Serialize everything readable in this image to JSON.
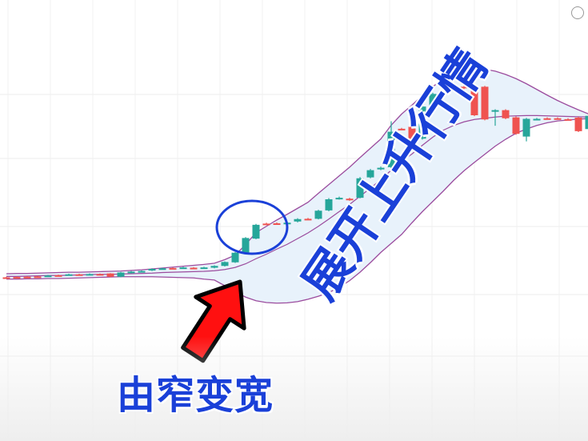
{
  "labels": {
    "bottom_caption": "由窄变宽",
    "diagonal_caption": "展开上升行情"
  },
  "colors": {
    "bull": "#26a69a",
    "bear": "#ef5350",
    "band": "#9b4c9e",
    "band_fill": "#e8f2fb",
    "annotation_blue": "#1a40d8",
    "arrow_red": "#ff1010"
  },
  "chart_data": {
    "type": "candlestick",
    "title": "",
    "xlabel": "",
    "ylabel": "",
    "grid": true,
    "ylim": [
      0,
      100
    ],
    "candles": [
      {
        "o": 11.6,
        "c": 11.6,
        "h": 11.8,
        "l": 11.4,
        "dir": "bear"
      },
      {
        "o": 11.7,
        "c": 11.7,
        "h": 11.9,
        "l": 11.5,
        "dir": "bear"
      },
      {
        "o": 11.8,
        "c": 11.8,
        "h": 12.0,
        "l": 11.6,
        "dir": "bear"
      },
      {
        "o": 11.9,
        "c": 11.9,
        "h": 12.1,
        "l": 11.7,
        "dir": "bear"
      },
      {
        "o": 12.0,
        "c": 12.2,
        "h": 12.4,
        "l": 11.8,
        "dir": "bull"
      },
      {
        "o": 12.3,
        "c": 12.3,
        "h": 12.5,
        "l": 12.1,
        "dir": "bear"
      },
      {
        "o": 12.4,
        "c": 12.6,
        "h": 12.8,
        "l": 12.2,
        "dir": "bull"
      },
      {
        "o": 12.6,
        "c": 12.6,
        "h": 12.8,
        "l": 12.4,
        "dir": "bear"
      },
      {
        "o": 12.7,
        "c": 12.7,
        "h": 12.9,
        "l": 12.5,
        "dir": "bull"
      },
      {
        "o": 12.7,
        "c": 12.7,
        "h": 12.9,
        "l": 12.5,
        "dir": "bear"
      },
      {
        "o": 12.9,
        "c": 11.8,
        "h": 13.0,
        "l": 11.6,
        "dir": "bear"
      },
      {
        "o": 11.8,
        "c": 13.2,
        "h": 13.4,
        "l": 11.6,
        "dir": "bull"
      },
      {
        "o": 13.1,
        "c": 13.5,
        "h": 13.7,
        "l": 12.9,
        "dir": "bull"
      },
      {
        "o": 13.5,
        "c": 13.7,
        "h": 13.9,
        "l": 13.3,
        "dir": "bull"
      },
      {
        "o": 13.9,
        "c": 14.4,
        "h": 14.6,
        "l": 13.7,
        "dir": "bull"
      },
      {
        "o": 14.4,
        "c": 14.6,
        "h": 14.8,
        "l": 14.2,
        "dir": "bull"
      },
      {
        "o": 14.7,
        "c": 14.6,
        "h": 14.9,
        "l": 14.4,
        "dir": "bear"
      },
      {
        "o": 14.7,
        "c": 14.9,
        "h": 15.1,
        "l": 14.5,
        "dir": "bull"
      },
      {
        "o": 14.8,
        "c": 14.6,
        "h": 15.0,
        "l": 14.4,
        "dir": "bear"
      },
      {
        "o": 14.7,
        "c": 14.9,
        "h": 15.1,
        "l": 14.5,
        "dir": "bull"
      },
      {
        "o": 14.8,
        "c": 15.4,
        "h": 15.6,
        "l": 14.6,
        "dir": "bull"
      },
      {
        "o": 15.4,
        "c": 16.7,
        "h": 16.9,
        "l": 15.2,
        "dir": "bull"
      },
      {
        "o": 16.6,
        "c": 19.8,
        "h": 20.0,
        "l": 16.4,
        "dir": "bull"
      },
      {
        "o": 19.8,
        "c": 24.7,
        "h": 25.0,
        "l": 19.6,
        "dir": "bull"
      },
      {
        "o": 24.5,
        "c": 29.1,
        "h": 29.4,
        "l": 24.3,
        "dir": "bull"
      },
      {
        "o": 29.5,
        "c": 29.5,
        "h": 29.8,
        "l": 29.2,
        "dir": "bear"
      },
      {
        "o": 29.6,
        "c": 29.4,
        "h": 29.9,
        "l": 29.2,
        "dir": "bear"
      },
      {
        "o": 29.6,
        "c": 29.8,
        "h": 30.1,
        "l": 29.4,
        "dir": "bull"
      },
      {
        "o": 30.2,
        "c": 31.0,
        "h": 31.3,
        "l": 29.9,
        "dir": "bull"
      },
      {
        "o": 31.1,
        "c": 31.0,
        "h": 31.4,
        "l": 30.8,
        "dir": "bear"
      },
      {
        "o": 31.1,
        "c": 33.8,
        "h": 34.1,
        "l": 30.9,
        "dir": "bull"
      },
      {
        "o": 33.9,
        "c": 37.6,
        "h": 38.0,
        "l": 33.6,
        "dir": "bull"
      },
      {
        "o": 37.7,
        "c": 38.1,
        "h": 38.5,
        "l": 37.5,
        "dir": "bull"
      },
      {
        "o": 37.8,
        "c": 37.4,
        "h": 38.1,
        "l": 37.1,
        "dir": "bear"
      },
      {
        "o": 38.1,
        "c": 44.6,
        "h": 45.0,
        "l": 37.9,
        "dir": "bull"
      },
      {
        "o": 44.9,
        "c": 47.3,
        "h": 47.7,
        "l": 44.6,
        "dir": "bull"
      },
      {
        "o": 47.6,
        "c": 48.1,
        "h": 48.5,
        "l": 47.3,
        "dir": "bull"
      },
      {
        "o": 48.3,
        "c": 60.1,
        "h": 63.6,
        "l": 48.0,
        "dir": "bull"
      },
      {
        "o": 61.1,
        "c": 61.1,
        "h": 61.4,
        "l": 60.8,
        "dir": "bear"
      },
      {
        "o": 61.8,
        "c": 57.2,
        "h": 62.1,
        "l": 56.9,
        "dir": "bear"
      },
      {
        "o": 57.8,
        "c": 68.5,
        "h": 68.9,
        "l": 57.5,
        "dir": "bull"
      },
      {
        "o": 68.4,
        "c": 72.7,
        "h": 73.1,
        "l": 68.1,
        "dir": "bull"
      },
      {
        "o": 72.6,
        "c": 73.8,
        "h": 74.2,
        "l": 72.3,
        "dir": "bull"
      },
      {
        "o": 74.1,
        "c": 74.8,
        "h": 75.2,
        "l": 73.8,
        "dir": "bull"
      },
      {
        "o": 75.1,
        "c": 74.6,
        "h": 76.6,
        "l": 74.3,
        "dir": "bear"
      },
      {
        "o": 74.9,
        "c": 65.6,
        "h": 75.2,
        "l": 65.3,
        "dir": "bear"
      },
      {
        "o": 75.1,
        "c": 64.2,
        "h": 75.4,
        "l": 63.9,
        "dir": "bear"
      },
      {
        "o": 67.3,
        "c": 67.3,
        "h": 67.6,
        "l": 62.1,
        "dir": "bull"
      },
      {
        "o": 67.3,
        "c": 64.6,
        "h": 67.6,
        "l": 64.3,
        "dir": "bear"
      },
      {
        "o": 64.9,
        "c": 59.4,
        "h": 65.2,
        "l": 59.1,
        "dir": "bear"
      },
      {
        "o": 58.5,
        "c": 64.4,
        "h": 64.7,
        "l": 56.9,
        "dir": "bull"
      },
      {
        "o": 64.4,
        "c": 64.4,
        "h": 64.7,
        "l": 64.1,
        "dir": "bull"
      },
      {
        "o": 64.6,
        "c": 64.6,
        "h": 64.9,
        "l": 64.3,
        "dir": "bear"
      },
      {
        "o": 64.6,
        "c": 64.6,
        "h": 64.9,
        "l": 64.3,
        "dir": "bear"
      },
      {
        "o": 64.3,
        "c": 64.3,
        "h": 64.6,
        "l": 64.0,
        "dir": "bear"
      },
      {
        "o": 64.8,
        "c": 60.3,
        "h": 65.1,
        "l": 60.0,
        "dir": "bear"
      },
      {
        "o": 65.4,
        "c": 61.0,
        "h": 65.7,
        "l": 49.9,
        "dir": "bull"
      }
    ],
    "bollinger": {
      "upper": [
        12.8,
        12.9,
        12.9,
        13.0,
        13.1,
        13.2,
        13.3,
        13.3,
        13.4,
        13.5,
        13.6,
        13.7,
        13.9,
        14.1,
        14.4,
        14.7,
        15.0,
        15.3,
        15.6,
        15.9,
        16.3,
        17.5,
        19.0,
        22.5,
        26.5,
        28.6,
        30.7,
        32.6,
        34.6,
        36.6,
        39.6,
        42.5,
        45.4,
        48.3,
        51.5,
        54.6,
        57.7,
        62.3,
        66.0,
        69.0,
        72.2,
        75.1,
        77.8,
        79.2,
        80.3,
        80.9,
        80.9,
        80.3,
        79.2,
        77.8,
        76.1,
        74.2,
        72.3,
        70.5,
        68.9,
        67.4,
        66.0
      ],
      "mid": [
        11.9,
        11.9,
        12.0,
        12.1,
        12.2,
        12.2,
        12.3,
        12.4,
        12.5,
        12.6,
        12.6,
        12.7,
        12.8,
        12.9,
        13.0,
        13.2,
        13.3,
        13.4,
        13.5,
        13.6,
        13.8,
        14.2,
        14.9,
        16.1,
        17.8,
        19.3,
        21.0,
        22.6,
        24.5,
        26.4,
        28.6,
        31.0,
        33.5,
        35.9,
        38.6,
        41.3,
        44.1,
        47.3,
        50.3,
        52.7,
        55.6,
        58.3,
        60.6,
        62.2,
        63.4,
        64.2,
        64.6,
        65.0,
        65.3,
        65.4,
        65.5,
        65.5,
        65.4,
        65.3,
        65.2,
        65.1,
        65.0
      ],
      "lower": [
        11.0,
        11.0,
        11.1,
        11.1,
        11.2,
        11.2,
        11.3,
        11.4,
        11.5,
        11.6,
        11.7,
        11.8,
        11.8,
        11.8,
        11.8,
        11.7,
        11.6,
        11.5,
        11.4,
        11.0,
        10.7,
        8.8,
        6.8,
        5.0,
        3.8,
        3.2,
        3.0,
        3.1,
        3.5,
        4.3,
        5.3,
        6.5,
        8.3,
        10.5,
        13.3,
        16.5,
        19.9,
        22.9,
        25.9,
        29.8,
        33.5,
        36.9,
        40.3,
        43.9,
        47.1,
        49.9,
        52.6,
        55.3,
        57.6,
        59.6,
        61.0,
        62.2,
        63.1,
        63.7,
        64.0,
        64.3,
        64.5
      ]
    }
  }
}
